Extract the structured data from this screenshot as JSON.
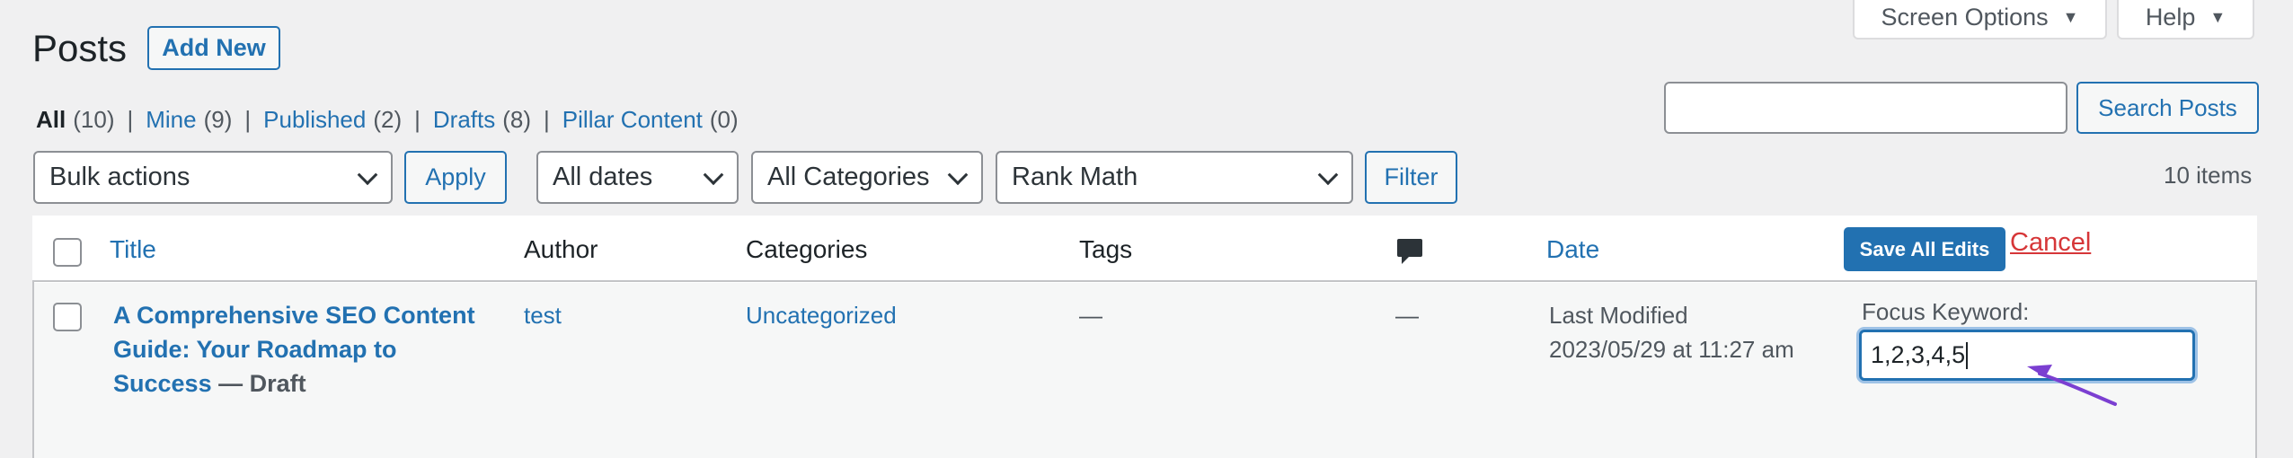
{
  "header": {
    "title": "Posts",
    "add_new": "Add New",
    "screen_options": "Screen Options",
    "help": "Help"
  },
  "views": [
    {
      "label": "All",
      "count": "(10)"
    },
    {
      "label": "Mine",
      "count": "(9)"
    },
    {
      "label": "Published",
      "count": "(2)"
    },
    {
      "label": "Drafts",
      "count": "(8)"
    },
    {
      "label": "Pillar Content",
      "count": "(0)"
    }
  ],
  "separator": "|",
  "search": {
    "value": "",
    "button": "Search Posts"
  },
  "toolbar": {
    "bulk_actions": "Bulk actions",
    "apply": "Apply",
    "dates": "All dates",
    "categories": "All Categories",
    "rank_math": "Rank Math",
    "filter": "Filter",
    "items_count": "10 items"
  },
  "table": {
    "columns": {
      "title": "Title",
      "author": "Author",
      "categories": "Categories",
      "tags": "Tags",
      "comments_icon": "comment-icon",
      "date": "Date"
    },
    "save_all_edits": "Save All Edits",
    "cancel": "Cancel",
    "rows": [
      {
        "title": "A Comprehensive SEO Content Guide: Your Roadmap to Success",
        "state": "— Draft",
        "author": "test",
        "categories": "Uncategorized",
        "tags": "—",
        "comments": "—",
        "date_status": "Last Modified",
        "date_value": "2023/05/29 at 11:27 am",
        "focus_keyword_label": "Focus Keyword:",
        "focus_keyword_value": "1,2,3,4,5"
      }
    ]
  },
  "colors": {
    "accent": "#2271b1",
    "danger": "#d63638",
    "annotation_arrow": "#7b3fd1"
  }
}
